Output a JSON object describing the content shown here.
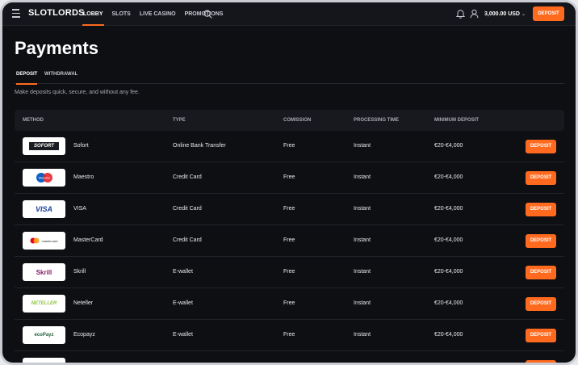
{
  "header": {
    "logo_text": "SLOTLORDS",
    "nav": [
      "LOBBY",
      "SLOTS",
      "LIVE CASINO",
      "PROMOTIONS"
    ],
    "active_nav": "LOBBY",
    "balance": "3,000.00 USD",
    "deposit_label": "DEPOSIT"
  },
  "page": {
    "title": "Payments",
    "tabs": [
      "DEPOSIT",
      "WITHDRAWAL"
    ],
    "active_tab": "DEPOSIT",
    "subtitle": "Make deposits quick, secure, and without any fee."
  },
  "table": {
    "headers": {
      "method": "METHOD",
      "type": "TYPE",
      "commission": "COMISSION",
      "processing": "PROCESSING TIME",
      "minimum": "MINIMUM DEPOSIT"
    },
    "rows": [
      {
        "name": "Sofort",
        "logo": "SOFORT",
        "type": "Online Bank Transfer",
        "commission": "Free",
        "processing": "Instant",
        "minimum": "€20-€4,000",
        "button": "DEPOSIT"
      },
      {
        "name": "Maestro",
        "logo": "Maestro",
        "type": "Credit Card",
        "commission": "Free",
        "processing": "Instant",
        "minimum": "€20-€4,000",
        "button": "DEPOSIT"
      },
      {
        "name": "VISA",
        "logo": "VISA",
        "type": "Credit Card",
        "commission": "Free",
        "processing": "Instant",
        "minimum": "€20-€4,000",
        "button": "DEPOSIT"
      },
      {
        "name": "MasterCard",
        "logo": "mastercard",
        "type": "Credit Card",
        "commission": "Free",
        "processing": "Instant",
        "minimum": "€20-€4,000",
        "button": "DEPOSIT"
      },
      {
        "name": "Skrill",
        "logo": "Skrill",
        "type": "E-wallet",
        "commission": "Free",
        "processing": "Instant",
        "minimum": "€20-€4,000",
        "button": "DEPOSIT"
      },
      {
        "name": "Neteller",
        "logo": "NETELLER",
        "type": "E-wallet",
        "commission": "Free",
        "processing": "Instant",
        "minimum": "€20-€4,000",
        "button": "DEPOSIT"
      },
      {
        "name": "Ecopayz",
        "logo": "ecoPayz",
        "type": "E-wallet",
        "commission": "Free",
        "processing": "Instant",
        "minimum": "€20-€4,000",
        "button": "DEPOSIT"
      }
    ]
  },
  "colors": {
    "accent": "#ff6a1f",
    "background": "#0e0f13"
  }
}
